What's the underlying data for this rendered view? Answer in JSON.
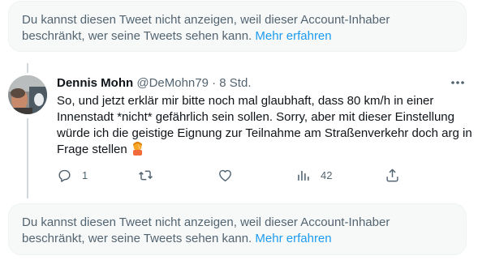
{
  "notices": [
    {
      "text": "Du kannst diesen Tweet nicht anzeigen, weil dieser Account-Inhaber beschränkt, wer seine Tweets sehen kann.",
      "link": "Mehr erfahren"
    },
    {
      "text": "Du kannst diesen Tweet nicht anzeigen, weil dieser Account-Inhaber beschränkt, wer seine Tweets sehen kann.",
      "link": "Mehr erfahren"
    }
  ],
  "tweet": {
    "author_name": "Dennis Mohn",
    "handle": "@DeMohn79",
    "separator": "·",
    "time": "8 Std.",
    "text": "So, und jetzt erklär mir bitte noch mal glaubhaft, dass 80 km/h in einer Innenstadt *nicht* gefährlich sein sollen. Sorry, aber mit dieser Einstellung würde ich die geistige Eignung zur Teilnahme am Straßenverkehr doch arg in Frage stellen",
    "emoji": "person-facepalming-emoji",
    "actions": {
      "reply_count": "1",
      "retweet_count": "",
      "like_count": "",
      "views_count": "42"
    }
  },
  "icons": {
    "more": "more-horizontal-icon",
    "reply": "reply-icon",
    "retweet": "retweet-icon",
    "like": "heart-icon",
    "views": "views-icon",
    "share": "share-icon"
  },
  "colors": {
    "link": "#1d9bf0",
    "secondary_text": "#536471",
    "notice_bg": "#f7f9f9",
    "thread_line": "#cfd9de"
  }
}
